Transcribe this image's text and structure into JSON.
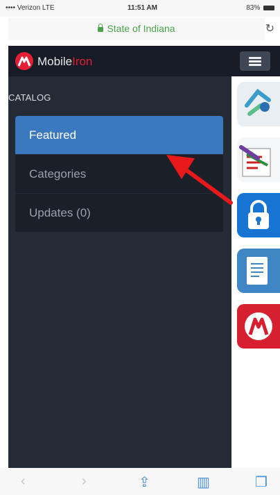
{
  "status_bar": {
    "carrier": "•••• Verizon  LTE",
    "time": "11:51 AM",
    "battery": "83%"
  },
  "browser": {
    "url": "State of Indiana",
    "url_color": "#4aa34a"
  },
  "app": {
    "brand_part1": "Mobile",
    "brand_part2": "Iron",
    "brand_color": "#e21f35",
    "menu_icon": "hamburger-icon",
    "section_label": "CATALOG",
    "menu": [
      {
        "label": "Featured",
        "active": true
      },
      {
        "label": "Categories",
        "active": false
      },
      {
        "label": "Updates (0)",
        "active": false
      }
    ],
    "accent": "#3a78c0",
    "app_icons": [
      "network-app-icon",
      "tools-checklist-app-icon",
      "lock-app-icon",
      "document-app-icon",
      "mobileiron-app-icon"
    ]
  },
  "annotation": {
    "type": "red-arrow",
    "color": "#e8191b",
    "points_to": "Featured"
  },
  "toolbar": [
    "back-icon",
    "forward-icon",
    "share-icon",
    "bookmarks-icon",
    "tabs-icon"
  ]
}
